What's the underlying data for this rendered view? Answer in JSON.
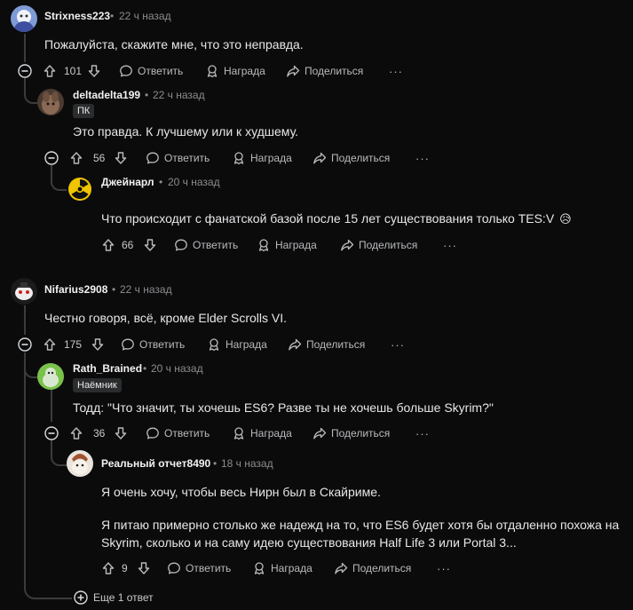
{
  "comments": {
    "c1": {
      "username": "Strixness223",
      "time": "22 ч назад",
      "text": "Пожалуйста, скажите мне, что это неправда.",
      "votes": "101"
    },
    "c1r1": {
      "username": "deltadelta199",
      "time": "22 ч назад",
      "flair": "ПК",
      "text": "Это правда. К лучшему или к худшему.",
      "votes": "56"
    },
    "c1r1r1": {
      "username": "Джейнарл",
      "time": "20 ч назад",
      "text": "Что происходит с фанатской базой после 15 лет существования только TES:V",
      "emoji": "😥",
      "votes": "66"
    },
    "c2": {
      "username": "Nifarius2908",
      "time": "22 ч назад",
      "text": "Честно говоря, всё, кроме Elder Scrolls VI.",
      "votes": "175"
    },
    "c2r1": {
      "username": "Rath_Brained",
      "time": "20 ч назад",
      "flair": "Наёмник",
      "text": "Тодд: \"Что значит, ты хочешь ES6? Разве ты не хочешь больше Skyrim?\"",
      "votes": "36"
    },
    "c2r1r1": {
      "username": "Реальный отчет8490",
      "time": "18 ч назад",
      "text_lines": [
        "Я очень хочу, чтобы весь Нирн был в Скайриме.",
        "Я питаю примерно столько же надежд на то, что ES6 будет хотя бы отдаленно похожа на",
        "Skyrim, сколько и на саму идею существования Half Life 3 или Portal 3..."
      ],
      "votes": "9"
    }
  },
  "actions": {
    "reply": "Ответить",
    "award": "Награда",
    "share": "Поделиться",
    "more": "···"
  },
  "separator": "•",
  "more_replies": "Еще 1 ответ",
  "icons": {
    "upvote": "arrow-up-icon",
    "downvote": "arrow-down-icon",
    "reply": "speech-bubble-icon",
    "award": "award-icon",
    "share": "share-arrow-icon",
    "collapse": "minus-circle-icon",
    "expand": "plus-circle-icon"
  },
  "colors": {
    "background": "#0b0b0c",
    "thread_line": "#3a3c3e",
    "text": "#e6e7e8",
    "muted": "#8a8c8e"
  }
}
